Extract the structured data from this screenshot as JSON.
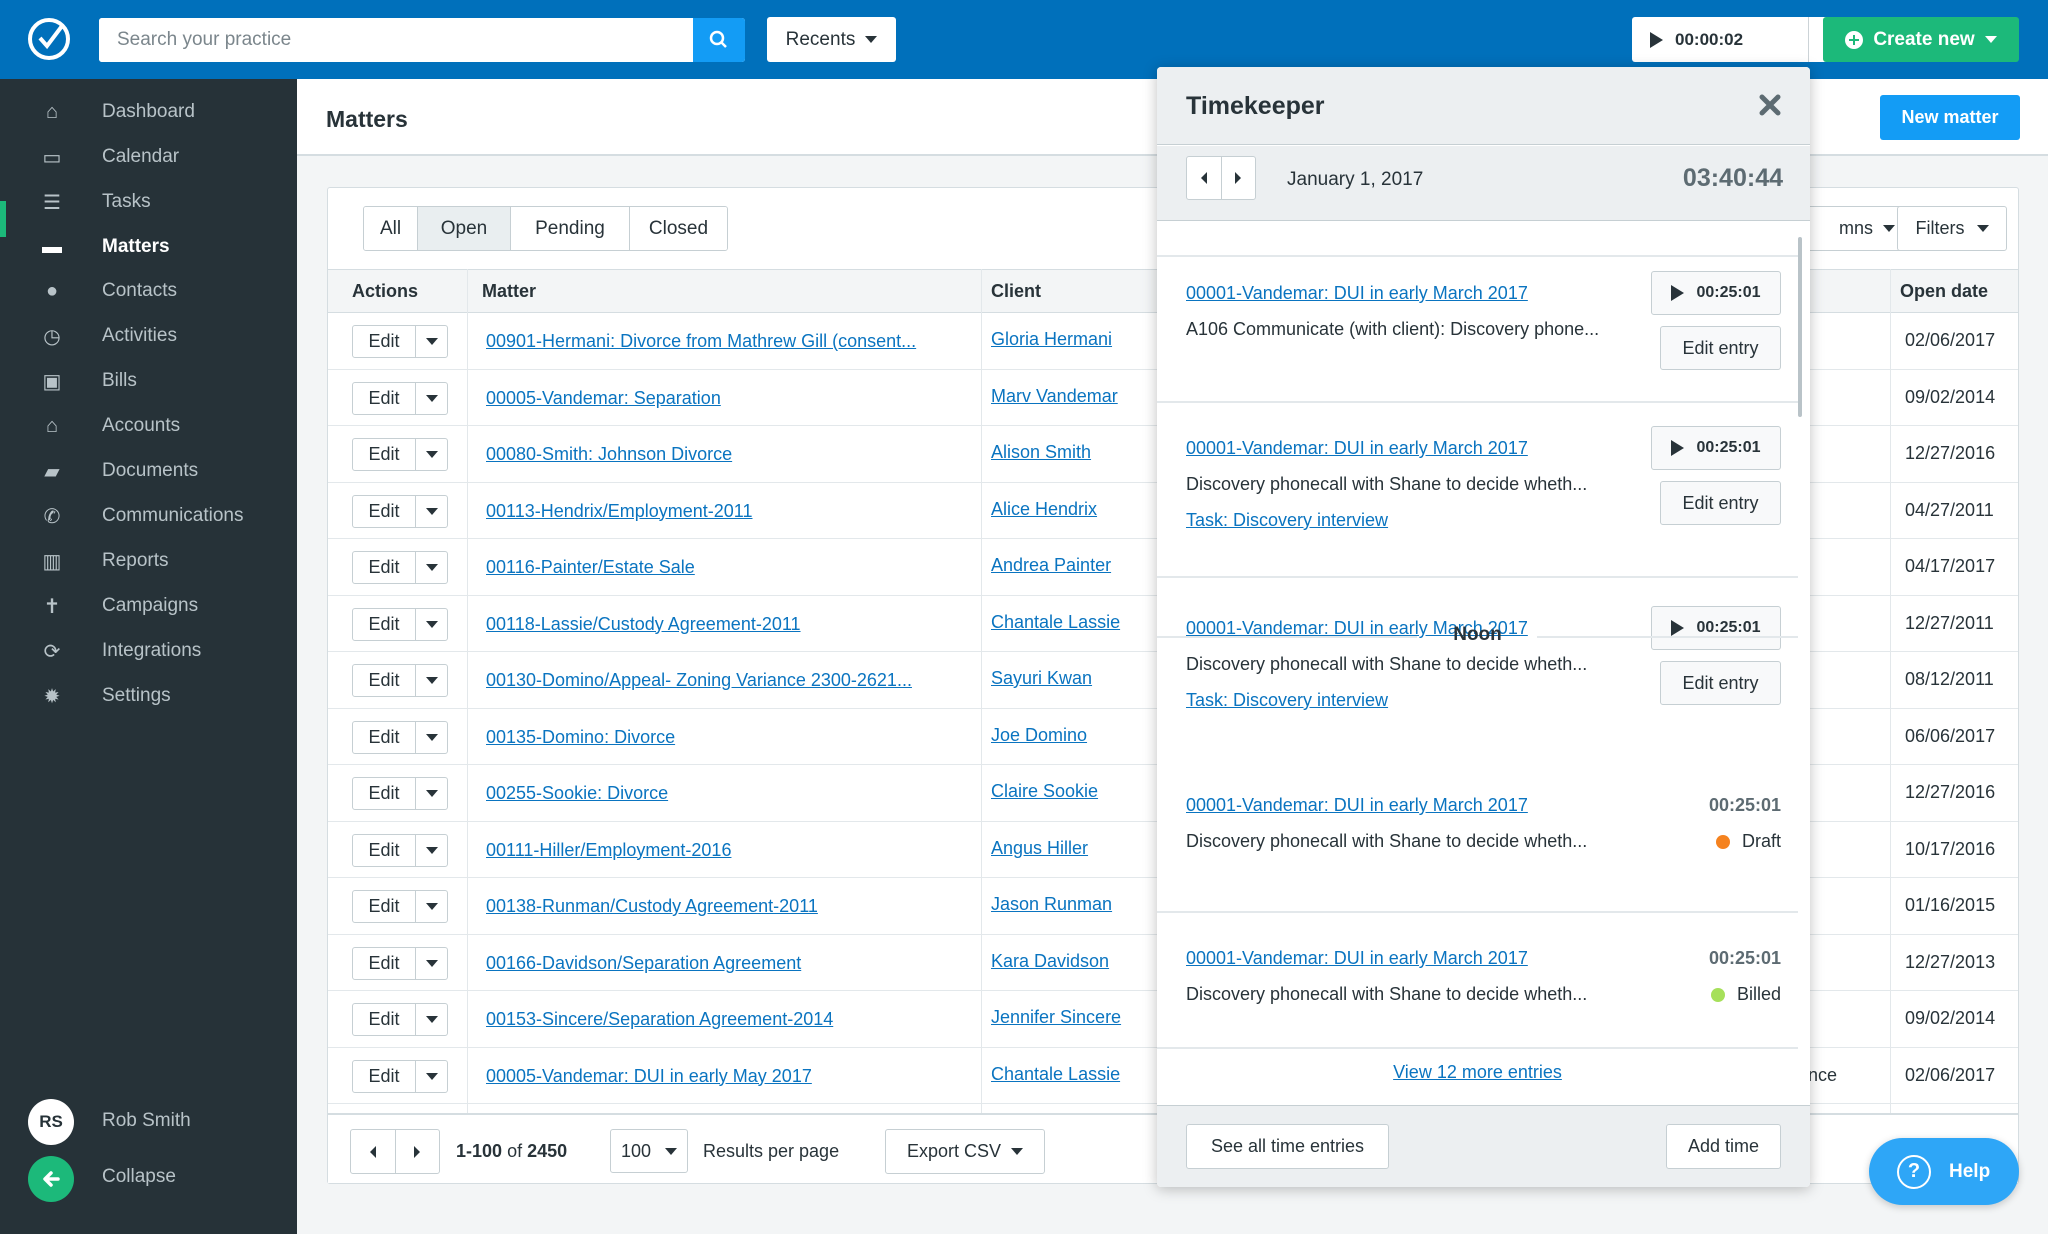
{
  "topbar": {
    "search_placeholder": "Search your practice",
    "recents_label": "Recents",
    "timer_value": "00:00:02",
    "create_new_label": "Create new"
  },
  "sidebar": {
    "items": [
      {
        "label": "Dashboard",
        "icon": "home-icon",
        "glyph": "⌂"
      },
      {
        "label": "Calendar",
        "icon": "calendar-icon",
        "glyph": "▭"
      },
      {
        "label": "Tasks",
        "icon": "list-icon",
        "glyph": "☰"
      },
      {
        "label": "Matters",
        "icon": "briefcase-icon",
        "glyph": "▬",
        "active": true
      },
      {
        "label": "Contacts",
        "icon": "person-icon",
        "glyph": "●"
      },
      {
        "label": "Activities",
        "icon": "clock-icon",
        "glyph": "◷"
      },
      {
        "label": "Bills",
        "icon": "money-icon",
        "glyph": "▣"
      },
      {
        "label": "Accounts",
        "icon": "bank-icon",
        "glyph": "⌂"
      },
      {
        "label": "Documents",
        "icon": "folder-icon",
        "glyph": "▰"
      },
      {
        "label": "Communications",
        "icon": "phone-icon",
        "glyph": "✆"
      },
      {
        "label": "Reports",
        "icon": "bar-chart-icon",
        "glyph": "▥"
      },
      {
        "label": "Campaigns",
        "icon": "campaign-person-icon",
        "glyph": "✝"
      },
      {
        "label": "Integrations",
        "icon": "sync-icon",
        "glyph": "⟳"
      },
      {
        "label": "Settings",
        "icon": "gear-icon",
        "glyph": "✹"
      }
    ],
    "user_initials": "RS",
    "user_name": "Rob Smith",
    "collapse_label": "Collapse"
  },
  "page": {
    "title": "Matters",
    "new_matter_label": "New matter"
  },
  "filters": {
    "segments": [
      {
        "label": "All",
        "selected": false
      },
      {
        "label": "Open",
        "selected": true
      },
      {
        "label": "Pending",
        "selected": false
      },
      {
        "label": "Closed",
        "selected": false
      }
    ],
    "columns_label": "mns",
    "filters_label": "Filters"
  },
  "table": {
    "headers": {
      "actions": "Actions",
      "matter": "Matter",
      "client": "Client",
      "open_date": "Open date"
    },
    "edit_label": "Edit",
    "rows": [
      {
        "matter": "00901-Hermani: Divorce from Mathrew Gill (consent...",
        "client": "Gloria Hermani",
        "open_date": "02/06/2017",
        "tail": ""
      },
      {
        "matter": "00005-Vandemar: Separation",
        "client": "Marv Vandemar",
        "open_date": "09/02/2014",
        "tail": ""
      },
      {
        "matter": "00080-Smith: Johnson Divorce",
        "client": "Alison Smith",
        "open_date": "12/27/2016",
        "tail": ""
      },
      {
        "matter": "00113-Hendrix/Employment-2011",
        "client": "Alice Hendrix",
        "open_date": "04/27/2011",
        "tail": ""
      },
      {
        "matter": "00116-Painter/Estate Sale",
        "client": "Andrea Painter",
        "open_date": "04/17/2017",
        "tail": ""
      },
      {
        "matter": "00118-Lassie/Custody Agreement-2011",
        "client": "Chantale Lassie",
        "open_date": "12/27/2011",
        "tail": ""
      },
      {
        "matter": "00130-Domino/Appeal- Zoning Variance 2300-2621...",
        "client": "Sayuri Kwan",
        "open_date": "08/12/2011",
        "tail": ""
      },
      {
        "matter": "00135-Domino: Divorce",
        "client": "Joe Domino",
        "open_date": "06/06/2017",
        "tail": ""
      },
      {
        "matter": "00255-Sookie: Divorce",
        "client": "Claire Sookie",
        "open_date": "12/27/2016",
        "tail": ""
      },
      {
        "matter": "00111-Hiller/Employment-2016",
        "client": "Angus Hiller",
        "open_date": "10/17/2016",
        "tail": ""
      },
      {
        "matter": "00138-Runman/Custody Agreement-2011",
        "client": "Jason Runman",
        "open_date": "01/16/2015",
        "tail": ""
      },
      {
        "matter": "00166-Davidson/Separation Agreement",
        "client": "Kara Davidson",
        "open_date": "12/27/2013",
        "tail": ""
      },
      {
        "matter": "00153-Sincere/Separation Agreement-2014",
        "client": "Jennifer Sincere",
        "open_date": "09/02/2014",
        "tail": ""
      },
      {
        "matter": "00005-Vandemar: DUI in early May 2017",
        "client": "Chantale Lassie",
        "open_date": "02/06/2017",
        "tail": "nce"
      }
    ]
  },
  "pagination": {
    "range_start_end": "1-100",
    "of": "of",
    "total": "2450",
    "per_page": "100",
    "per_page_label": "Results per page",
    "export_label": "Export CSV"
  },
  "timekeeper": {
    "title": "Timekeeper",
    "date": "January 1, 2017",
    "total": "03:40:44",
    "noon_label": "Noon",
    "entries": [
      {
        "matter": "00001-Vandemar: DUI in early March 2017",
        "description": "A106 Communicate (with client): Discovery phone...",
        "task": "",
        "duration": "00:25:01",
        "play": true,
        "edit_label": "Edit entry"
      },
      {
        "matter": "00001-Vandemar: DUI in early March 2017",
        "description": "Discovery phonecall with Shane to decide wheth...",
        "task": "Task: Discovery interview",
        "duration": "00:25:01",
        "play": true,
        "edit_label": "Edit entry"
      },
      {
        "matter": "00001-Vandemar: DUI in early March 2017",
        "description": "Discovery phonecall with Shane to decide wheth...",
        "task": "Task: Discovery interview",
        "duration": "00:25:01",
        "play": true,
        "edit_label": "Edit entry"
      },
      {
        "matter": "00001-Vandemar: DUI in early March 2017",
        "description": "Discovery phonecall with Shane to decide wheth...",
        "task": "",
        "duration": "00:25:01",
        "play": false,
        "status": "Draft",
        "status_color": "#f5821f"
      },
      {
        "matter": "00001-Vandemar: DUI in early March 2017",
        "description": "Discovery phonecall with Shane to decide wheth...",
        "task": "",
        "duration": "00:25:01",
        "play": false,
        "status": "Billed",
        "status_color": "#a6e05a"
      }
    ],
    "view_more_label": "View 12 more entries",
    "see_all_label": "See all time entries",
    "add_time_label": "Add time"
  },
  "help": {
    "label": "Help"
  },
  "colors": {
    "topbar": "#0070bb",
    "primary_blue": "#139cf5",
    "green": "#1cb97a",
    "sidebar": "#263238",
    "link": "#0a74c0"
  }
}
